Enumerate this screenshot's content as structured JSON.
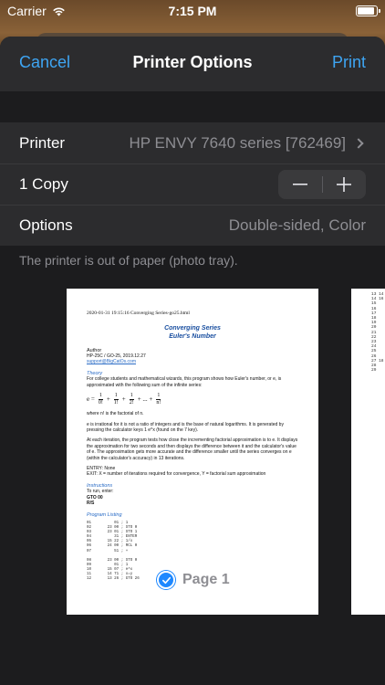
{
  "status": {
    "carrier": "Carrier",
    "time": "7:15 PM"
  },
  "nav": {
    "cancel": "Cancel",
    "title": "Printer Options",
    "print": "Print"
  },
  "options": {
    "printer_label": "Printer",
    "printer_value": "HP ENVY 7640 series [762469]",
    "copies_label": "1 Copy",
    "options_label": "Options",
    "options_value": "Double-sided, Color",
    "note": "The printer is out of paper (photo tray)."
  },
  "preview": {
    "page_label": "Page 1",
    "doc_header": "2020-01-31 19:15:16 Converging Series-go25.html",
    "doc_title_1": "Converging Series",
    "doc_title_2": "Euler's Number",
    "author_heading": "Author",
    "author_line": "HP-25C / GO-25, 2019.12.27",
    "author_email": "support@BigCatOs.com",
    "theory_heading": "Theory",
    "theory_text": "For college students and mathematical wizards, this program shows how Euler's number, or e, is approximated with the following sum of the infinite series:",
    "formula_lhs": "e =",
    "formula_ellipsis": "+ ... +",
    "where_text": "where n! is the factorial of n.",
    "irrational_text": "e is irrational for it is not a ratio of integers and is the base of natural logarithms. It is generated by pressing the calculator keys 1 e^x (found on the 7 key).",
    "iteration_text": "At each iteration, the program tests how close the incrementing factorial approximation is to e. It displays the approximation for two seconds and then displays the difference between it and the calculator's value of e. The approximation gets more accurate and the difference smaller until the series converges on e (within the calculator's accuracy) in 13 iterations.",
    "entry_text": "ENTRY: None",
    "exit_text": "EXIT: X = number of iterations required for convergence, Y = factorial sum approximation",
    "instructions_heading": "Instructions",
    "instructions_text": "To run, enter:",
    "instr_gto": "GTO 00",
    "instr_rs": "R/S",
    "listing_heading": "Program Listing",
    "listing": "01          01 ; 1\n02       23 00 ; STO 0\n03       23 01 ; STO 1\n04          31 ; ENTER\n05       15 22 ; 1/x\n06       24 00 ; RCL 0\n07          51 ; +\n\n08       23 00 ; STO 0\n09          01 ; 1\n10       15 07 ; e^x\n11       14 71 ; x=y\n12       13 26 ; GTO 26",
    "page2_listing": "13 14\n14 16\n15\n16\n17\n18\n19\n20\n21\n22\n23\n24\n25\n26\n27 18\n28\n29"
  }
}
